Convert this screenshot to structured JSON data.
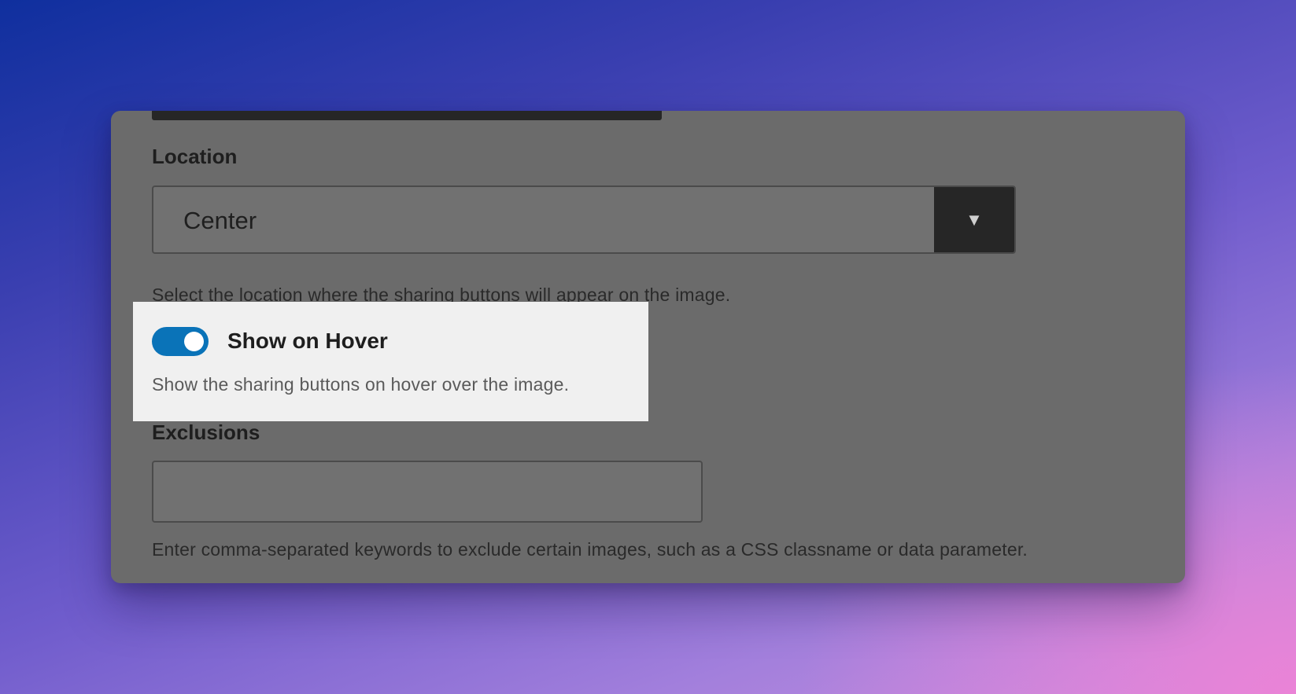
{
  "location": {
    "label": "Location",
    "selected": "Center",
    "dropdown_icon": "▼",
    "help": "Select the location where the sharing buttons will appear on the image."
  },
  "hover": {
    "enabled": true,
    "label": "Show on Hover",
    "help": "Show the sharing buttons on hover over the image.",
    "accent_color": "#0a73b8"
  },
  "exclusions": {
    "label": "Exclusions",
    "value": "",
    "help": "Enter comma-separated keywords to exclude certain images, such as a CSS classname or data parameter."
  }
}
